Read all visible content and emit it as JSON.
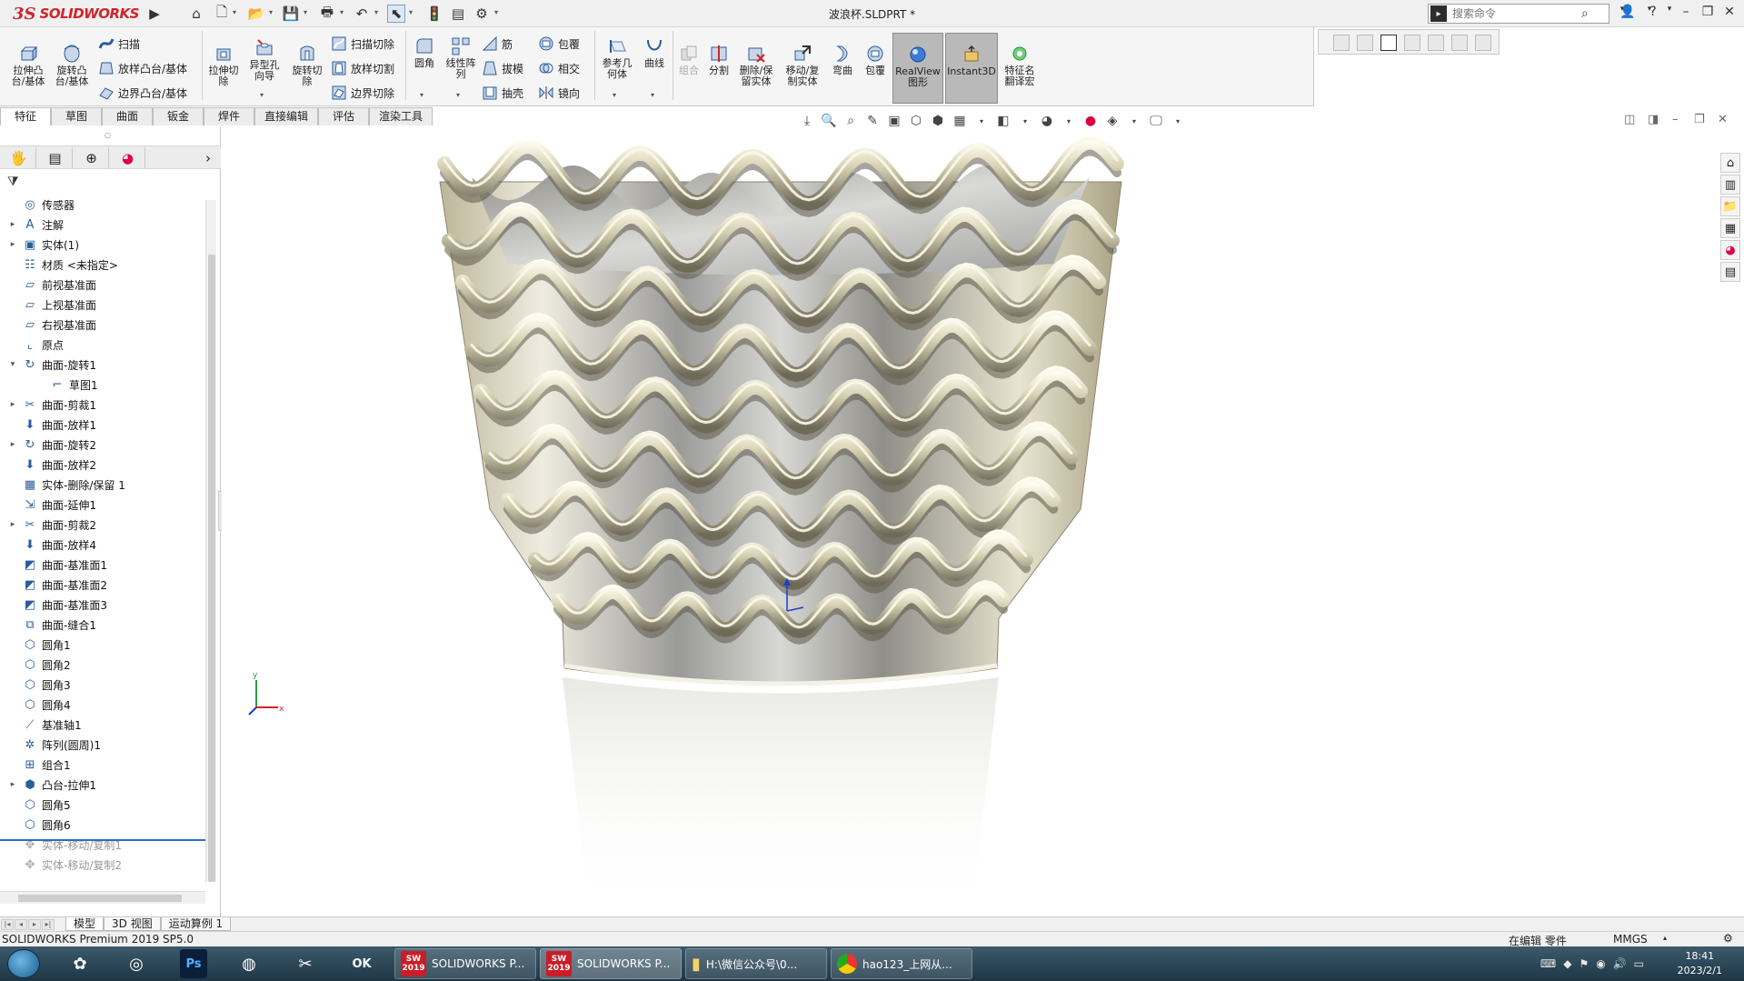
{
  "app": {
    "logo_ds": "3S",
    "logo_text": "SOLIDWORKS",
    "document_title": "波浪杯.SLDPRT *",
    "search_placeholder": "搜索命令"
  },
  "command_manager": {
    "large_tools_1": [
      {
        "label": "拉伸凸\n台/基体"
      },
      {
        "label": "旋转凸\n台/基体"
      }
    ],
    "small_tools_1": [
      "扫描",
      "放样凸台/基体",
      "边界凸台/基体"
    ],
    "large_tools_2": [
      {
        "label": "拉伸切\n除"
      },
      {
        "label": "异型孔\n向导"
      },
      {
        "label": "旋转切\n除"
      }
    ],
    "small_tools_2": [
      "扫描切除",
      "放样切割",
      "边界切除"
    ],
    "large_tools_3": [
      {
        "label": "圆角"
      },
      {
        "label": "线性阵\n列"
      }
    ],
    "small_tools_3": [
      "筋",
      "拔模",
      "抽壳"
    ],
    "small_tools_4": [
      "包覆",
      "相交",
      "镜向"
    ],
    "large_tools_4": [
      {
        "label": "参考几\n何体"
      },
      {
        "label": "曲线"
      },
      {
        "label": "组合"
      },
      {
        "label": "分割"
      },
      {
        "label": "删除/保\n留实体"
      },
      {
        "label": "移动/复\n制实体"
      },
      {
        "label": "弯曲"
      },
      {
        "label": "包覆"
      },
      {
        "label": "RealView\n图形"
      },
      {
        "label": "Instant3D"
      },
      {
        "label": "特征名\n翻译宏"
      }
    ]
  },
  "tabs": [
    "特征",
    "草图",
    "曲面",
    "钣金",
    "焊件",
    "直接编辑",
    "评估",
    "渲染工具"
  ],
  "feature_tree": [
    {
      "label": "传感器",
      "icon": "sensor-icon",
      "exp": ""
    },
    {
      "label": "注解",
      "icon": "annotation-icon",
      "exp": "▸"
    },
    {
      "label": "实体(1)",
      "icon": "solid-body-icon",
      "exp": "▸"
    },
    {
      "label": "材质 <未指定>",
      "icon": "material-icon",
      "exp": ""
    },
    {
      "label": "前视基准面",
      "icon": "plane-icon",
      "exp": ""
    },
    {
      "label": "上视基准面",
      "icon": "plane-icon",
      "exp": ""
    },
    {
      "label": "右视基准面",
      "icon": "plane-icon",
      "exp": ""
    },
    {
      "label": "原点",
      "icon": "origin-icon",
      "exp": ""
    },
    {
      "label": "曲面-旋转1",
      "icon": "surface-revolve-icon",
      "exp": "▾"
    },
    {
      "label": "草图1",
      "icon": "sketch-icon",
      "exp": "",
      "indent": true
    },
    {
      "label": "曲面-剪裁1",
      "icon": "surface-trim-icon",
      "exp": "▸"
    },
    {
      "label": "曲面-放样1",
      "icon": "surface-loft-icon",
      "exp": ""
    },
    {
      "label": "曲面-旋转2",
      "icon": "surface-revolve-icon",
      "exp": "▸"
    },
    {
      "label": "曲面-放样2",
      "icon": "surface-loft-icon",
      "exp": ""
    },
    {
      "label": "实体-删除/保留 1",
      "icon": "delete-body-icon",
      "exp": ""
    },
    {
      "label": "曲面-延伸1",
      "icon": "surface-extend-icon",
      "exp": ""
    },
    {
      "label": "曲面-剪裁2",
      "icon": "surface-trim-icon",
      "exp": "▸"
    },
    {
      "label": "曲面-放样4",
      "icon": "surface-loft-icon",
      "exp": ""
    },
    {
      "label": "曲面-基准面1",
      "icon": "planar-surface-icon",
      "exp": ""
    },
    {
      "label": "曲面-基准面2",
      "icon": "planar-surface-icon",
      "exp": ""
    },
    {
      "label": "曲面-基准面3",
      "icon": "planar-surface-icon",
      "exp": ""
    },
    {
      "label": "曲面-缝合1",
      "icon": "knit-surface-icon",
      "exp": ""
    },
    {
      "label": "圆角1",
      "icon": "fillet-icon",
      "exp": ""
    },
    {
      "label": "圆角2",
      "icon": "fillet-icon",
      "exp": ""
    },
    {
      "label": "圆角3",
      "icon": "fillet-icon",
      "exp": ""
    },
    {
      "label": "圆角4",
      "icon": "fillet-icon",
      "exp": ""
    },
    {
      "label": "基准轴1",
      "icon": "axis-icon",
      "exp": ""
    },
    {
      "label": "阵列(圆周)1",
      "icon": "circular-pattern-icon",
      "exp": ""
    },
    {
      "label": "组合1",
      "icon": "combine-icon",
      "exp": ""
    },
    {
      "label": "凸台-拉伸1",
      "icon": "extrude-icon",
      "exp": "▸"
    },
    {
      "label": "圆角5",
      "icon": "fillet-icon",
      "exp": ""
    },
    {
      "label": "圆角6",
      "icon": "fillet-icon",
      "exp": ""
    },
    {
      "label": "实体-移动/复制1",
      "icon": "move-body-icon",
      "exp": "",
      "grey": true
    },
    {
      "label": "实体-移动/复制2",
      "icon": "move-body-icon",
      "exp": "",
      "grey": true
    }
  ],
  "bottom_tabs": [
    "模型",
    "3D 视图",
    "运动算例 1"
  ],
  "status": {
    "product": "SOLIDWORKS Premium 2019 SP5.0",
    "editing": "在编辑 零件",
    "units": "MMGS"
  },
  "triad": {
    "x": "x",
    "y": "y"
  },
  "taskbar": {
    "apps": [
      {
        "label": "SOLIDWORKS P..."
      },
      {
        "label": "SOLIDWORKS P..."
      },
      {
        "label": "H:\\微信公众号\\0..."
      },
      {
        "label": "hao123_上网从..."
      }
    ],
    "sw_badge": "SW\n2019",
    "time": "18:41",
    "date": "2023/2/1"
  },
  "colors": {
    "accent": "#2b6cc4",
    "brand": "#d2232a",
    "metal_light": "#e6e2cf",
    "metal_dark": "#6f6a58"
  }
}
